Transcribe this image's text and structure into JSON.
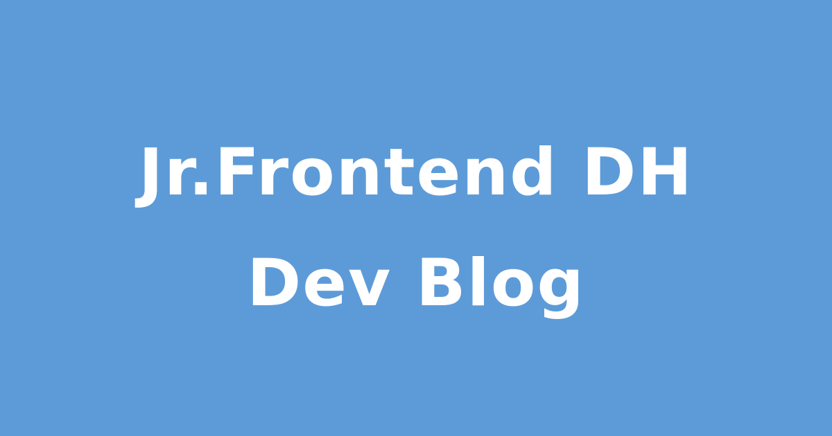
{
  "colors": {
    "background": "#5d9bd8",
    "text": "#ffffff"
  },
  "title": {
    "line1": "Jr.Frontend DH",
    "line2": "Dev Blog"
  }
}
